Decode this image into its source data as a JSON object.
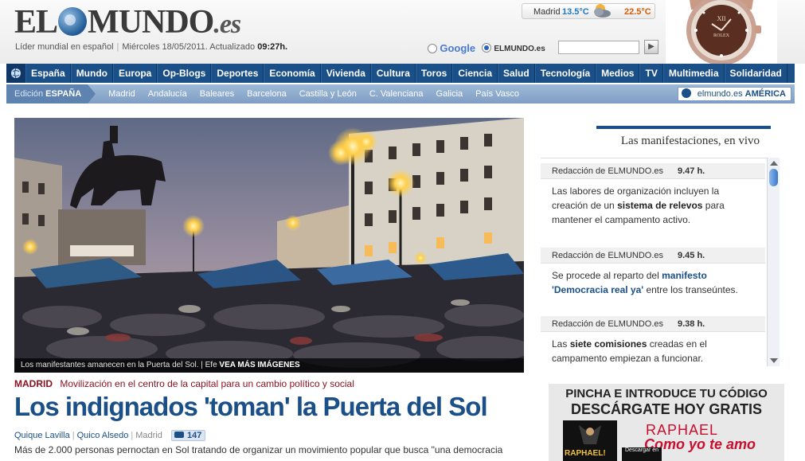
{
  "header": {
    "logo": {
      "el": "EL",
      "mundo": "MUNDO",
      "es": ".es"
    },
    "tagline": "Líder mundial en español",
    "date": "Miércoles 18/05/2011. Actualizado",
    "updated_time": "09:27h.",
    "weather": {
      "city": "Madrid",
      "min": "13.5°C",
      "max": "22.5°C",
      "icon": "partly-cloudy-icon"
    },
    "search": {
      "option_google": "Google",
      "option_elmundo": "ELMUNDO.es",
      "selected": "ELMUNDO.es",
      "value": ""
    }
  },
  "main_nav": {
    "items": [
      "España",
      "Mundo",
      "Europa",
      "Op-Blogs",
      "Deportes",
      "Economía",
      "Vivienda",
      "Cultura",
      "Toros",
      "Ciencia",
      "Salud",
      "Tecnología",
      "Medios",
      "TV",
      "Multimedia",
      "Solidaridad"
    ]
  },
  "sub_nav": {
    "edition_label": "Edición",
    "edition_name": "ESPAÑA",
    "items": [
      "Madrid",
      "Andalucía",
      "Baleares",
      "Barcelona",
      "Castilla y León",
      "C. Valenciana",
      "Galicia",
      "País Vasco"
    ],
    "america": "elmundo.es",
    "america_bold": "AMÉRICA"
  },
  "article": {
    "caption": "Los manifestantes amanecen en la Puerta del Sol. | Efe",
    "caption_link": "VEA MÁS IMÁGENES",
    "section": "MADRID",
    "kicker": "Movilización en el centro de la capital para un cambio político y social",
    "headline": "Los indignados 'toman' la Puerta del Sol",
    "author1": "Quique Lavilla",
    "author2": "Quico Alsedo",
    "location": "Madrid",
    "comments": "147",
    "lede": "Más de 2.000 personas pernoctan en Sol tratando de organizar un movimiento popular que busca \"una democracia"
  },
  "live": {
    "title": "Las manifestaciones, en vivo",
    "entries": [
      {
        "source": "Redacción de ELMUNDO.es",
        "time": "9.47 h.",
        "text_a": "Las labores de organización incluyen la creación de un ",
        "bold": "sistema de relevos",
        "text_b": " para mantener el campamento activo."
      },
      {
        "source": "Redacción de ELMUNDO.es",
        "time": "9.45 h.",
        "text_a": "Se procede al reparto del ",
        "bold": "manifesto 'Democracia real ya'",
        "text_b": " entre los transeúntes."
      },
      {
        "source": "Redacción de ELMUNDO.es",
        "time": "9.38 h.",
        "text_a": "Las ",
        "bold": "siete comisiones",
        "text_b": " creadas en el campamento empiezan a funcionar."
      }
    ]
  },
  "ad": {
    "line1": "PINCHA E INTRODUCE TU CÓDIGO",
    "line2": "DESCÁRGATE HOY GRATIS",
    "cover_text": "RAPHAEL!",
    "artist": "RAPHAEL",
    "song": "Como yo te amo",
    "download": "Descargar en"
  },
  "colors": {
    "nav": "#1b4f87",
    "subnav": "#8fadd0",
    "section": "#8a1320",
    "headline": "#1b4f87"
  }
}
